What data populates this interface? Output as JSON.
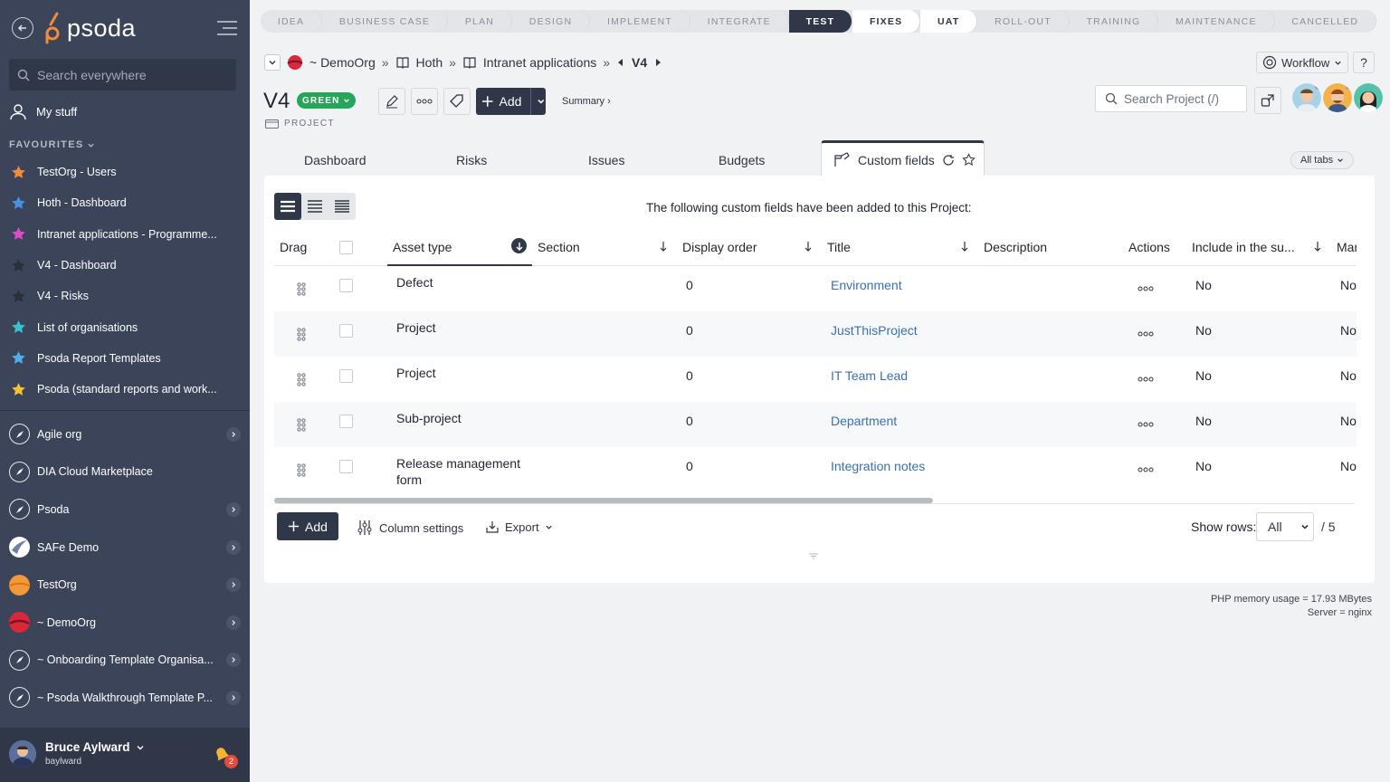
{
  "sidebar": {
    "logo_text": "psoda",
    "search_placeholder": "Search everywhere",
    "my_stuff": "My stuff",
    "favourites_label": "FAVOURITES",
    "favourites": [
      {
        "label": "TestOrg - Users",
        "color": "#f08c3a"
      },
      {
        "label": "Hoth - Dashboard",
        "color": "#4a90e2"
      },
      {
        "label": "Intranet applications - Programme...",
        "color": "#d94fc9"
      },
      {
        "label": "V4 - Dashboard",
        "color": "#2a2f3a"
      },
      {
        "label": "V4 - Risks",
        "color": "#2a2f3a"
      },
      {
        "label": "List of organisations",
        "color": "#3ac0d4"
      },
      {
        "label": "Psoda Report Templates",
        "color": "#4ab0e8"
      },
      {
        "label": "Psoda (standard reports and work...",
        "color": "#f2c230"
      }
    ],
    "orgs": [
      {
        "label": "Agile org",
        "icon": "compass-icon",
        "chevron": true
      },
      {
        "label": "DIA Cloud Marketplace",
        "icon": "compass-icon",
        "chevron": false
      },
      {
        "label": "Psoda",
        "icon": "compass-icon",
        "chevron": true
      },
      {
        "label": "SAFe Demo",
        "icon": "safe-logo-icon",
        "chevron": true
      },
      {
        "label": "TestOrg",
        "icon": "orange-planet-icon",
        "chevron": true
      },
      {
        "label": "~ DemoOrg",
        "icon": "red-planet-icon",
        "chevron": true
      },
      {
        "label": "~ Onboarding Template Organisa...",
        "icon": "compass-icon",
        "chevron": true
      },
      {
        "label": "~ Psoda Walkthrough Template P...",
        "icon": "compass-icon",
        "chevron": true
      }
    ],
    "user": {
      "name": "Bruce Aylward",
      "login": "baylward",
      "notifications": "2"
    }
  },
  "phases": [
    {
      "label": "IDEA",
      "state": "past"
    },
    {
      "label": "BUSINESS CASE",
      "state": "past"
    },
    {
      "label": "PLAN",
      "state": "past"
    },
    {
      "label": "DESIGN",
      "state": "past"
    },
    {
      "label": "IMPLEMENT",
      "state": "past"
    },
    {
      "label": "INTEGRATE",
      "state": "past"
    },
    {
      "label": "TEST",
      "state": "active"
    },
    {
      "label": "FIXES",
      "state": "white"
    },
    {
      "label": "UAT",
      "state": "white"
    },
    {
      "label": "ROLL-OUT",
      "state": "past"
    },
    {
      "label": "TRAINING",
      "state": "past"
    },
    {
      "label": "MAINTENANCE",
      "state": "past"
    },
    {
      "label": "CANCELLED",
      "state": "past"
    }
  ],
  "breadcrumb": {
    "org": "~ DemoOrg",
    "programme": "Hoth",
    "project_group": "Intranet applications",
    "current": "V4",
    "sep": "»"
  },
  "header": {
    "title": "V4",
    "status": "GREEN",
    "type": "PROJECT",
    "add_label": "Add",
    "summary_label": "Summary ›",
    "workflow_label": "Workflow",
    "help_label": "?",
    "search_placeholder": "Search Project (/)"
  },
  "tabs": {
    "items": [
      "Dashboard",
      "Risks",
      "Issues",
      "Budgets"
    ],
    "active": "Custom fields",
    "all_tabs": "All tabs"
  },
  "grid": {
    "caption": "The following custom fields have been added to this Project:",
    "columns": {
      "drag": "Drag",
      "asset_type": "Asset type",
      "section": "Section",
      "display_order": "Display order",
      "title": "Title",
      "description": "Description",
      "actions": "Actions",
      "include": "Include in the su...",
      "mandatory": "Mar"
    },
    "rows": [
      {
        "asset_type": "Defect",
        "asset_type_2": "",
        "section": "",
        "display_order": "0",
        "title": "Environment",
        "description": "",
        "include": "No",
        "mandatory": "No"
      },
      {
        "asset_type": "Project",
        "asset_type_2": "",
        "section": "",
        "display_order": "0",
        "title": "JustThisProject",
        "description": "",
        "include": "No",
        "mandatory": "No"
      },
      {
        "asset_type": "Project",
        "asset_type_2": "",
        "section": "",
        "display_order": "0",
        "title": "IT Team Lead",
        "description": "",
        "include": "No",
        "mandatory": "No"
      },
      {
        "asset_type": "Sub-project",
        "asset_type_2": "",
        "section": "",
        "display_order": "0",
        "title": "Department",
        "description": "",
        "include": "No",
        "mandatory": "No"
      },
      {
        "asset_type": "Release management",
        "asset_type_2": "form",
        "section": "",
        "display_order": "0",
        "title": "Integration notes",
        "description": "",
        "include": "No",
        "mandatory": "No"
      }
    ],
    "footer": {
      "add": "Add",
      "column_settings": "Column settings",
      "export": "Export",
      "show_rows": "Show rows:",
      "rows_value": "All",
      "total": "/ 5"
    }
  },
  "server": {
    "memory": "PHP memory usage = 17.93 MBytes",
    "server": "Server = nginx"
  }
}
